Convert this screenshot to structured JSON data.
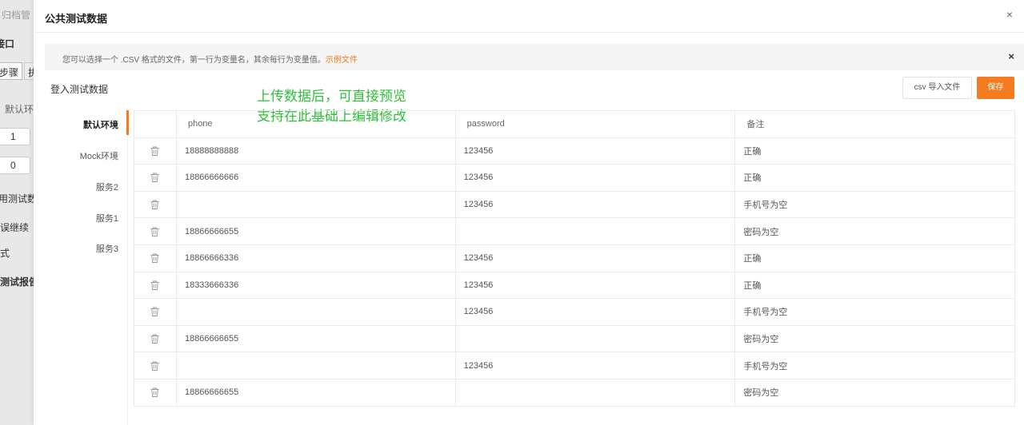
{
  "background": {
    "archive_label": "归档管",
    "port_label": "接口",
    "steps_label": "步骤",
    "steps_tab2": "执",
    "default_env": "默认环境",
    "value1": "1",
    "value2": "0",
    "use_test_data": "用测试数",
    "error_continue": "误继续",
    "mode": "式",
    "test_report": "测试报告"
  },
  "drawer": {
    "title": "公共测试数据",
    "close": "×"
  },
  "notice": {
    "text": "您可以选择一个 .CSV 格式的文件，第一行为变量名，其余每行为变量值。",
    "link": "示例文件",
    "close": "×"
  },
  "section": {
    "title": "登入测试数据",
    "import_button": "csv 导入文件",
    "save_button": "保存"
  },
  "annotation": {
    "line1": "上传数据后，可直接预览",
    "line2": "支持在此基础上编辑修改"
  },
  "environments": [
    {
      "label": "默认环境",
      "active": true
    },
    {
      "label": "Mock环境",
      "active": false
    },
    {
      "label": "服务2",
      "active": false
    },
    {
      "label": "服务1",
      "active": false
    },
    {
      "label": "服务3",
      "active": false
    }
  ],
  "table": {
    "columns": [
      "phone",
      "password",
      "备注"
    ],
    "rows": [
      [
        "18888888888",
        "123456",
        "正确"
      ],
      [
        "18866666666",
        "123456",
        "正确"
      ],
      [
        "",
        "123456",
        "手机号为空"
      ],
      [
        "18866666655",
        "",
        "密码为空"
      ],
      [
        "18866666336",
        "123456",
        "正确"
      ],
      [
        "18333666336",
        "123456",
        "正确"
      ],
      [
        "",
        "123456",
        "手机号为空"
      ],
      [
        "18866666655",
        "",
        "密码为空"
      ],
      [
        "",
        "123456",
        "手机号为空"
      ],
      [
        "18866666655",
        "",
        "密码为空"
      ]
    ]
  },
  "icons": {
    "row_delete": "trash-icon",
    "close": "close-icon"
  },
  "colors": {
    "accent": "#f47b20",
    "annotation": "#2fbf3a",
    "link": "#f07a1a"
  }
}
